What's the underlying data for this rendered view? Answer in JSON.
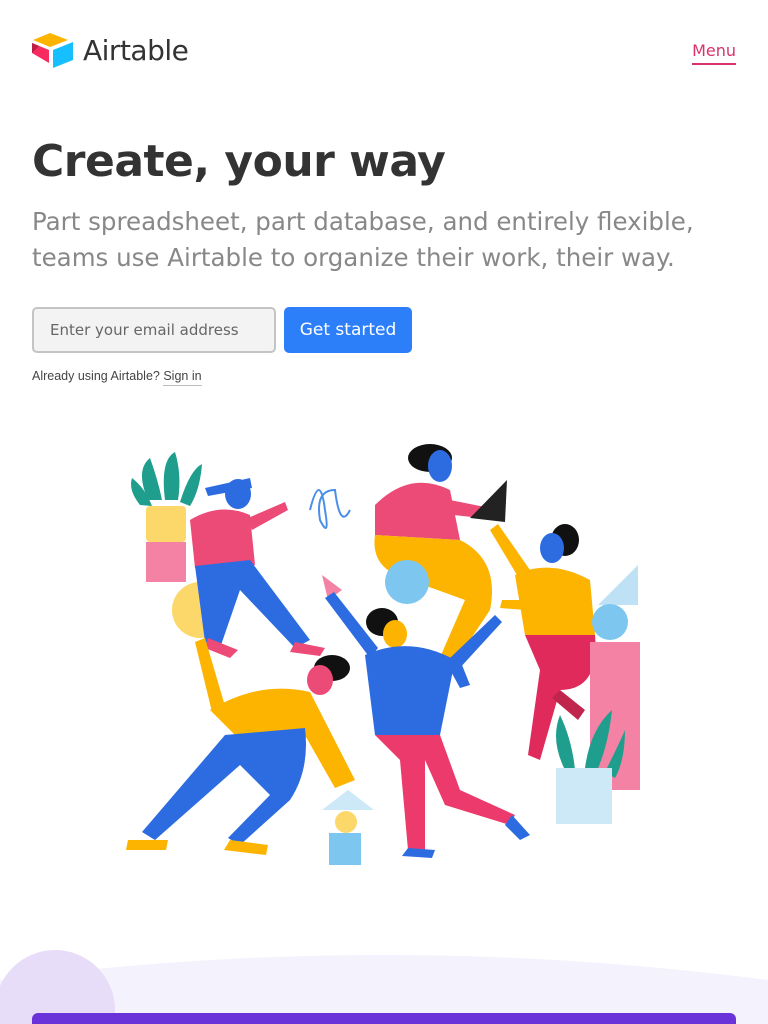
{
  "header": {
    "brand_name": "Airtable",
    "menu_label": "Menu",
    "logo_icon": "airtable-logo-icon"
  },
  "hero": {
    "title": "Create, your way",
    "subtitle": "Part spreadsheet, part database, and entirely flexible, teams use Airtable to organize their work, their way."
  },
  "signup": {
    "email_placeholder": "Enter your email address",
    "button_label": "Get started",
    "signin_prefix": "Already using Airtable?",
    "signin_link": "Sign in"
  },
  "colors": {
    "brand_pink": "#d9316b",
    "cta_blue": "#2d7ff9",
    "bottom_purple": "#6a33d9"
  }
}
